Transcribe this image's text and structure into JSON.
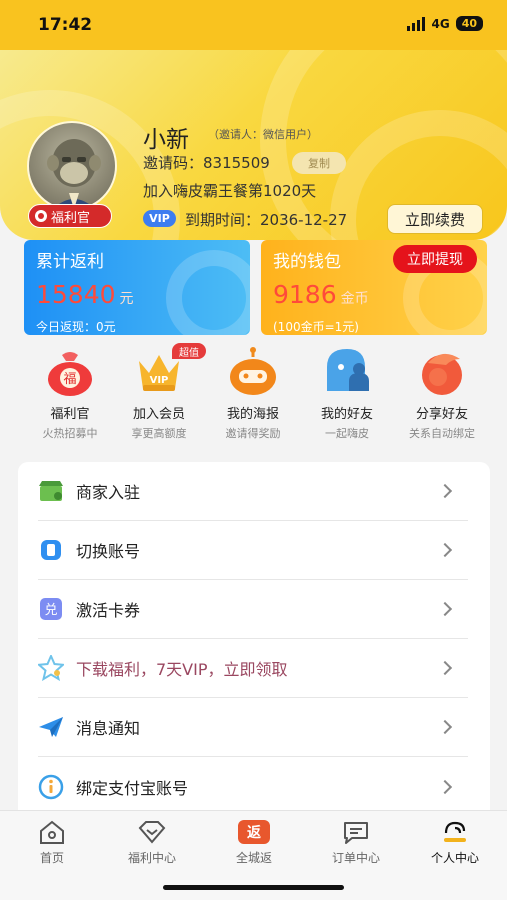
{
  "status": {
    "time": "17:42",
    "network": "4G",
    "battery": "40"
  },
  "profile": {
    "nickname": "小新",
    "inviter": "（邀请人：微信用户）",
    "invite_code_label": "邀请码：8315509",
    "copy_label": "复制",
    "join_text": "加入嗨皮霸王餐第1020天",
    "vip_tag": "VIP",
    "expire_text": "到期时间：2036-12-27",
    "renew_label": "立即续费",
    "badge_label": "福利官"
  },
  "cards": {
    "rebate": {
      "title": "累计返利",
      "amount": "15840",
      "unit": "元",
      "footer": "今日返现：0元"
    },
    "wallet": {
      "title": "我的钱包",
      "amount": "9186",
      "unit": "金币",
      "footer": "(100金币=1元)",
      "withdraw_label": "立即提现"
    }
  },
  "quick_actions": [
    {
      "label": "福利官",
      "sub": "火热招募中"
    },
    {
      "label": "加入会员",
      "sub": "享更高额度",
      "tag": "超值"
    },
    {
      "label": "我的海报",
      "sub": "邀请得奖励"
    },
    {
      "label": "我的好友",
      "sub": "一起嗨皮"
    },
    {
      "label": "分享好友",
      "sub": "关系自动绑定"
    }
  ],
  "menu": [
    {
      "label": "商家入驻"
    },
    {
      "label": "切换账号"
    },
    {
      "label": "激活卡券"
    },
    {
      "label": "下载福利，7天VIP，立即领取"
    },
    {
      "label": "消息通知"
    },
    {
      "label": "绑定支付宝账号"
    }
  ],
  "tabs": [
    {
      "label": "首页"
    },
    {
      "label": "福利中心"
    },
    {
      "label": "全城返"
    },
    {
      "label": "订单中心"
    },
    {
      "label": "个人中心"
    }
  ],
  "icon_glyphs": {
    "duihuan": "兑",
    "fan": "返",
    "fu": "福"
  },
  "colors": {
    "brand_yellow": "#f9c31f",
    "rebate_blue": "#1e90f5",
    "wallet_orange": "#ffb21c",
    "accent_red": "#e5131b",
    "amount_red": "#ff4a3a"
  }
}
